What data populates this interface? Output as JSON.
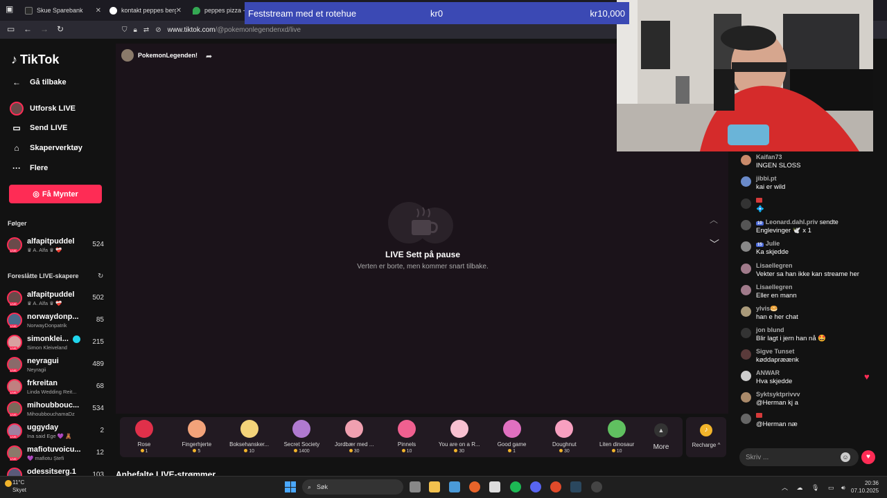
{
  "browser": {
    "tabs": [
      {
        "title": "Skue Sparebank",
        "favicon_color": "#2a2a2a"
      },
      {
        "title": "kontakt peppes bergen",
        "favicon_color": "#ffffff"
      },
      {
        "title": "peppes pizza - Go",
        "favicon_color": "#34a853"
      }
    ],
    "url_domain": "www.tiktok.com",
    "url_path": "/@pokemonlegendenxd/live"
  },
  "fundraiser": {
    "title": "Feststream med et rotehue",
    "amount": "kr0",
    "goal": "kr10,000"
  },
  "sidebar": {
    "logo": "TikTok",
    "nav": [
      {
        "label": "Gå tilbake",
        "icon": "arrow-left-icon"
      },
      {
        "label": "Utforsk LIVE",
        "icon": "avatar-icon"
      },
      {
        "label": "Send LIVE",
        "icon": "video-camera-icon"
      },
      {
        "label": "Skaperverktøy",
        "icon": "home-tools-icon"
      },
      {
        "label": "Flere",
        "icon": "more-dots-icon"
      }
    ],
    "coins_button": "Få Mynter",
    "following_heading": "Følger",
    "following": [
      {
        "name": "alfapitpuddel",
        "sub": "♛ A. Alfa ♛ ❤️‍🩹",
        "count": "524"
      }
    ],
    "suggested_heading": "Foreslåtte LIVE-skapere",
    "suggested": [
      {
        "name": "alfapitpuddel",
        "sub": "♛ A. Alfa ♛ ❤️‍🩹",
        "count": "502"
      },
      {
        "name": "norwaydonp...",
        "sub": "NorwayDonpatrik",
        "count": "85"
      },
      {
        "name": "simonklei...",
        "sub": "Simon Kleiveland",
        "count": "215"
      },
      {
        "name": "neyragui",
        "sub": "Neyragii",
        "count": "489"
      },
      {
        "name": "frkreitan",
        "sub": "Linda Wedding Reit...",
        "count": "68"
      },
      {
        "name": "mihoubbouc...",
        "sub": "MihoubbouchamaDz",
        "count": "534"
      },
      {
        "name": "uggyday",
        "sub": "Ina said Ege 💜 🧸",
        "count": "2"
      },
      {
        "name": "mafiotuvoicu...",
        "sub": "💜 mafiotu Ștefi",
        "count": "12"
      },
      {
        "name": "odessitserg.1",
        "sub": "",
        "count": "103"
      }
    ],
    "live_badge": "LIVE"
  },
  "stage": {
    "host_name": "PokemonLegenden!",
    "pause_title": "LIVE Sett på pause",
    "pause_subtitle": "Verten er borte, men kommer snart tilbake."
  },
  "gifts": [
    {
      "name": "Rose",
      "price": "1",
      "color": "#e0304a"
    },
    {
      "name": "Fingerhjerte",
      "price": "5",
      "color": "#f2a37a"
    },
    {
      "name": "Boksehansker...",
      "price": "10",
      "color": "#f3d37a"
    },
    {
      "name": "Secret Society",
      "price": "1400",
      "color": "#b07ad0"
    },
    {
      "name": "Jordbær med ...",
      "price": "30",
      "color": "#f0a0b0"
    },
    {
      "name": "Pinnels",
      "price": "10",
      "color": "#f06090"
    },
    {
      "name": "You are on a R...",
      "price": "30",
      "color": "#f7c0d0"
    },
    {
      "name": "Good game",
      "price": "1",
      "color": "#e070c0"
    },
    {
      "name": "Doughnut",
      "price": "30",
      "color": "#f7a0c0"
    },
    {
      "name": "Liten dinosaur",
      "price": "10",
      "color": "#60c060"
    }
  ],
  "gift_more": "More",
  "recharge": "Recharge",
  "recommended_heading": "Anbefalte LIVE-strømmer",
  "chat": {
    "messages": [
      {
        "user": "Kaifan73",
        "text": "INGEN SLOSS",
        "avatar_color": "#c98a6a"
      },
      {
        "user": "jibbi.pt",
        "text": "kai er wild",
        "avatar_color": "#6a8ac9"
      },
      {
        "user": "",
        "text": "💠",
        "avatar_color": "#333333"
      },
      {
        "user": "Leonard.dahl.priv",
        "badge": "10",
        "text": "Englevinger 🕊️ x 1",
        "suffix": "sendte",
        "avatar_color": "#555555"
      },
      {
        "user": "Julie",
        "badge": "15",
        "text": "Ka skjedde",
        "avatar_color": "#888888"
      },
      {
        "user": "Lisaellegren",
        "text": "Vekter sa han ikke kan streame her",
        "avatar_color": "#a07a8a"
      },
      {
        "user": "Lisaellegren",
        "text": "Eller en mann",
        "avatar_color": "#a07a8a"
      },
      {
        "user": "ylvis🥯",
        "text": "han e her chat",
        "avatar_color": "#aa9a7a"
      },
      {
        "user": "jon blund",
        "text": "Blir lagt i jern han nå 🤩",
        "avatar_color": "#333333"
      },
      {
        "user": "Sigve Tunset",
        "text": "køddapræænk",
        "avatar_color": "#5a3a3a"
      },
      {
        "user": "ANWAR",
        "text": "Hva skjedde",
        "avatar_color": "#cccccc"
      },
      {
        "user": "Syktsyktprivvv",
        "text": "@Herman kj a",
        "avatar_color": "#aa8a6a"
      },
      {
        "user": "",
        "text": "@Herman næ",
        "avatar_color": "#666666"
      }
    ],
    "input_placeholder": "Skriv ..."
  },
  "taskbar": {
    "weather_temp": "11°C",
    "weather_desc": "Skyet",
    "search_label": "Søk",
    "time": "20:36",
    "date": "07.10.2025"
  }
}
